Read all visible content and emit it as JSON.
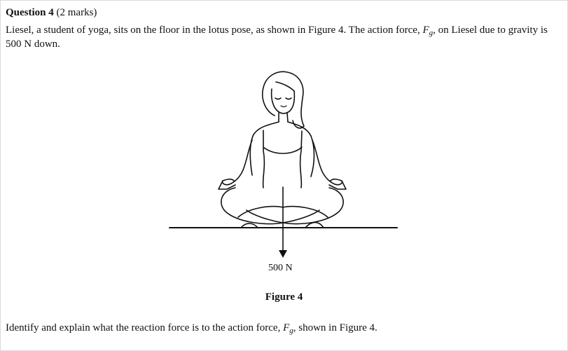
{
  "question": {
    "number_label": "Question 4",
    "marks": "(2 marks)"
  },
  "stem": {
    "part1": "Liesel, a student of yoga, sits on the floor in the lotus pose, as shown in Figure 4. The action force, ",
    "symbol": "F",
    "subscript": "g",
    "part2": ", on Liesel due to gravity is 500 N down."
  },
  "figure": {
    "force_label": "500 N",
    "caption": "Figure 4"
  },
  "prompt": {
    "part1": "Identify and explain what the reaction force is to the action force, ",
    "symbol": "F",
    "subscript": "g",
    "part2": ", shown in Figure 4."
  }
}
